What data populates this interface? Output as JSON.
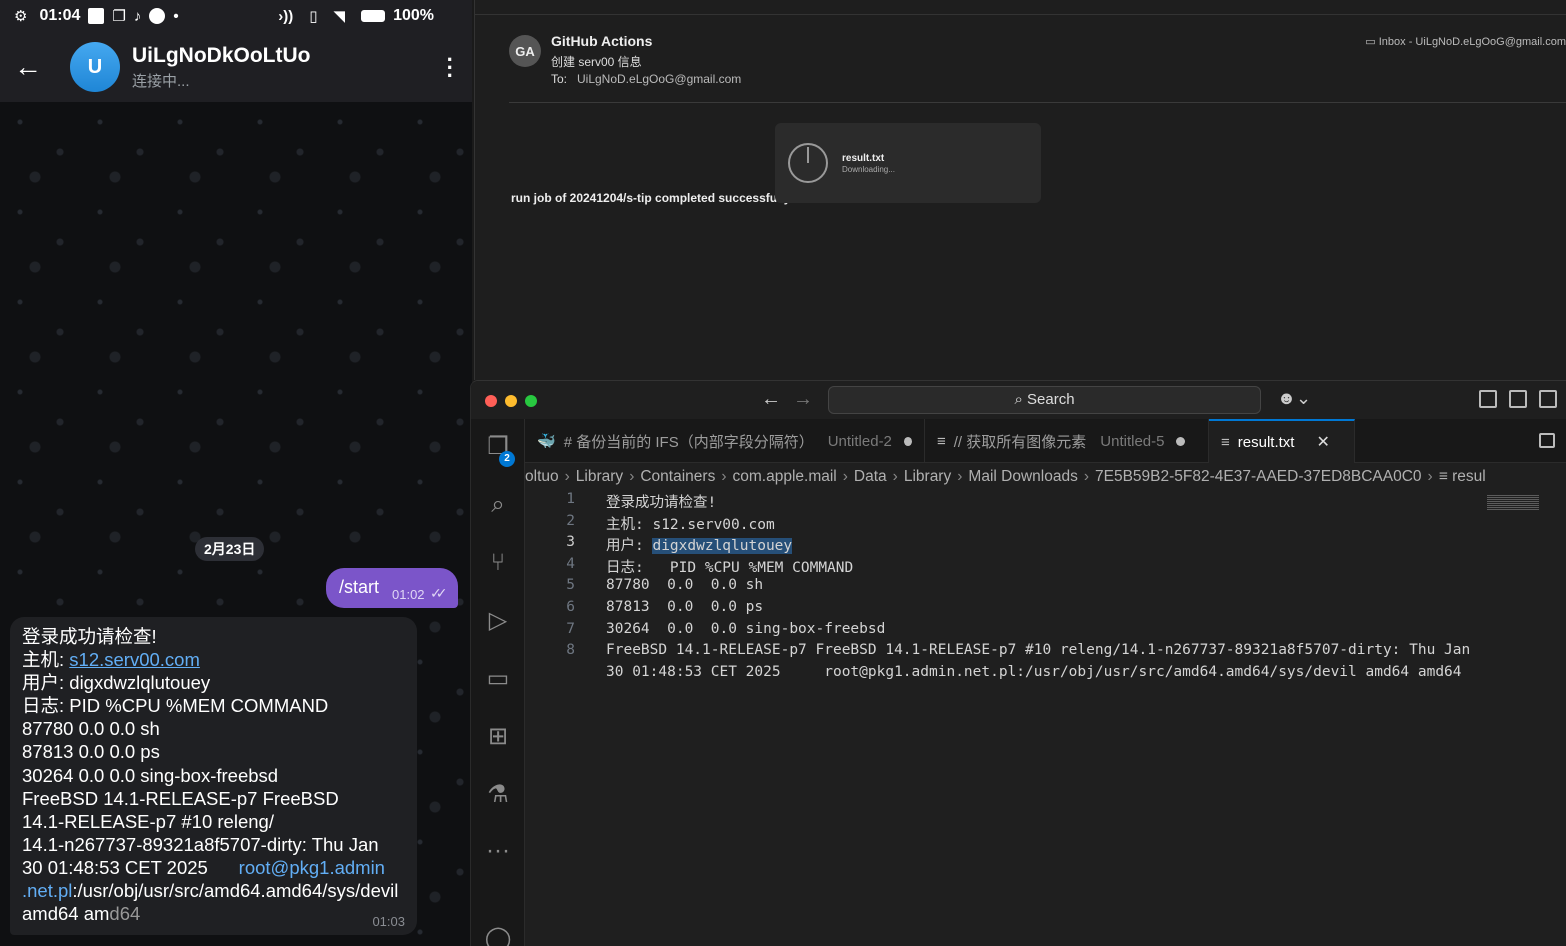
{
  "phone": {
    "statusbar": {
      "time": "01:04",
      "battery": "100%"
    },
    "header": {
      "avatar_letter": "U",
      "title": "UiLgNoDkOoLtUo",
      "status": "连接中..."
    },
    "date_chip": "2月23日",
    "start_message": {
      "text": "/start",
      "time": "01:02"
    },
    "result_message": {
      "lines": [
        "登录成功请检查!",
        "主机: ",
        "s12.serv00.com",
        "用户: digxdwzlqlutouey",
        "日志:   PID %CPU %MEM COMMAND",
        "87780  0.0  0.0 sh",
        "87813  0.0  0.0 ps",
        "30264  0.0  0.0 sing-box-freebsd",
        "FreeBSD 14.1-RELEASE-p7 FreeBSD",
        "14.1-RELEASE-p7 #10 releng/",
        "14.1-n267737-89321a8f5707-dirty: Thu Jan",
        "30 01:48:53 CET 2025      ",
        "root@pkg1.admin",
        ".net.pl",
        ":/usr/obj/usr/src/amd64.amd64/sys/devil",
        "amd64 am",
        "d64"
      ],
      "time": "01:03"
    }
  },
  "mail": {
    "avatar": "GA",
    "sender": "GitHub Actions",
    "subject": "创建 serv00 信息",
    "to_label": "To:",
    "to": "UiLgNoD.eLgOoG@gmail.com",
    "inbox": "Inbox - UiLgNoD.eLgOoG@gmail.com",
    "body": "run job of 20241204/s-tip completed successfully!",
    "attachment": {
      "name": "result.txt",
      "status": "Downloading..."
    }
  },
  "vscode": {
    "search": "Search",
    "explorer_badge": "2",
    "tabs": [
      {
        "title": "# 备份当前的 IFS（内部字段分隔符）",
        "sub": "Untitled-2"
      },
      {
        "title": "// 获取所有图像元素",
        "sub": "Untitled-5"
      },
      {
        "title": "result.txt"
      }
    ],
    "breadcrumb": [
      "oltuo",
      "Library",
      "Containers",
      "com.apple.mail",
      "Data",
      "Library",
      "Mail Downloads",
      "7E5B59B2-5F82-4E37-AAED-37ED8BCAA0C0",
      "resul"
    ],
    "lines": [
      "登录成功请检查!",
      "主机: s12.serv00.com",
      "用户: ",
      "digxdwzlqlutouey",
      "日志:   PID %CPU %MEM COMMAND",
      "87780  0.0  0.0 sh",
      "87813  0.0  0.0 ps",
      "30264  0.0  0.0 sing-box-freebsd",
      "FreeBSD 14.1-RELEASE-p7 FreeBSD 14.1-RELEASE-p7 #10 releng/14.1-n267737-89321a8f5707-dirty: Thu Jan",
      "30 01:48:53 CET 2025     root@pkg1.admin.net.pl:/usr/obj/usr/src/amd64.amd64/sys/devil amd64 amd64"
    ],
    "line_numbers": [
      "1",
      "2",
      "3",
      "4",
      "5",
      "6",
      "7",
      "8"
    ]
  }
}
